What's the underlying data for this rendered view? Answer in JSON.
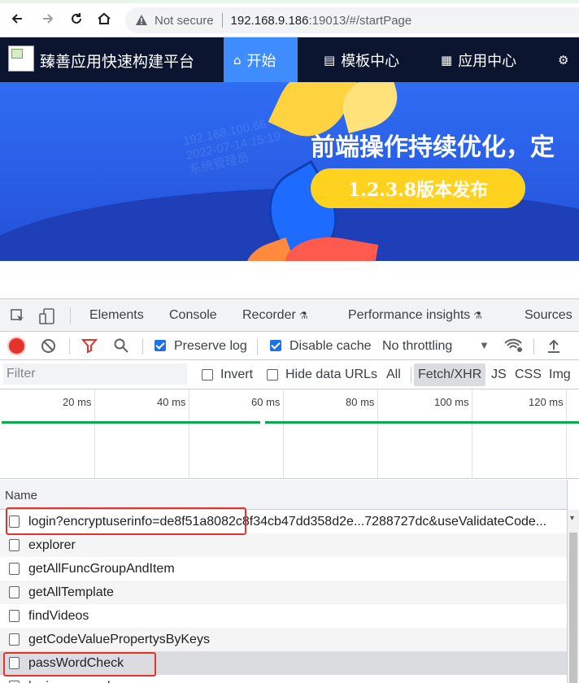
{
  "browser": {
    "security_label": "Not secure",
    "url_host": "192.168.9.186",
    "url_path": ":19013/#/startPage",
    "icons": [
      "back-icon",
      "forward-icon",
      "reload-icon",
      "home-icon",
      "warning-icon"
    ]
  },
  "app": {
    "title": "臻善应用快速构建平台",
    "nav": [
      {
        "label": "开始",
        "icon": "home-icon",
        "active": true
      },
      {
        "label": "模板中心",
        "icon": "template-icon",
        "active": false
      },
      {
        "label": "应用中心",
        "icon": "grid-icon",
        "active": false
      }
    ],
    "nav_truncated_icon": "user-gear-icon"
  },
  "banner": {
    "title": "前端操作持续优化，定",
    "pill": "1.2.3.8版本发布",
    "watermark_lines": [
      "192.168.100.66",
      "2022-07-14 15:19",
      "系统管理员"
    ]
  },
  "devtools": {
    "tabs": [
      "Elements",
      "Console",
      "Recorder",
      "Performance insights",
      "Sources"
    ],
    "toolbar": {
      "preserve_log": "Preserve log",
      "disable_cache": "Disable cache",
      "throttling": "No throttling"
    },
    "filter": {
      "placeholder": "Filter",
      "invert": "Invert",
      "hide_data_urls": "Hide data URLs",
      "types": [
        "All",
        "Fetch/XHR",
        "JS",
        "CSS",
        "Img"
      ],
      "active_type": "Fetch/XHR"
    },
    "timeline_ticks": [
      "20 ms",
      "40 ms",
      "60 ms",
      "80 ms",
      "100 ms",
      "120 ms"
    ],
    "table": {
      "column_name": "Name",
      "rows": [
        "login?encryptuserinfo=de8f51a8082c8f34cb47dd358d2e...7288727dc&useValidateCode...",
        "explorer",
        "getAllFuncGroupAndItem",
        "getAllTemplate",
        "findVideos",
        "getCodeValuePropertysByKeys",
        "passWordCheck",
        "loginsuccessdo"
      ]
    },
    "colors": {
      "record": "#e5322b",
      "filter_active": "#e5322b",
      "checkbox": "#1a73e8",
      "highlight": "#e5322b"
    }
  }
}
